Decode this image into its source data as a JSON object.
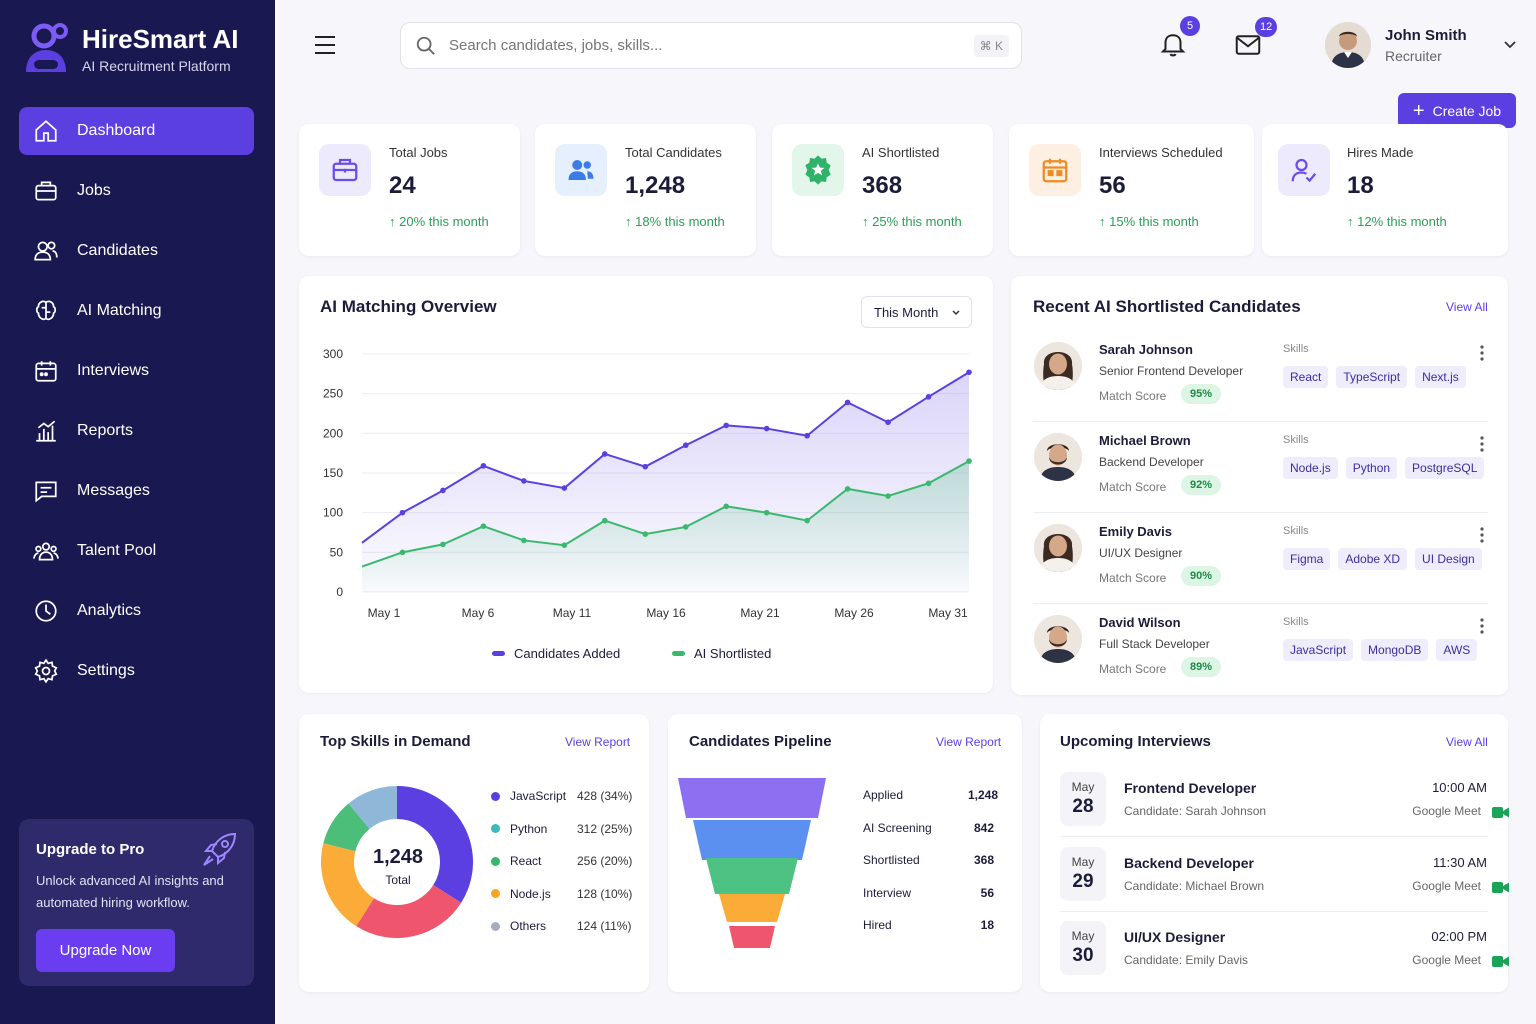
{
  "brand": {
    "name": "HireSmart AI",
    "subtitle": "AI Recruitment Platform"
  },
  "nav": [
    {
      "label": "Dashboard",
      "icon": "home-icon",
      "active": true
    },
    {
      "label": "Jobs",
      "icon": "briefcase-icon"
    },
    {
      "label": "Candidates",
      "icon": "users-icon"
    },
    {
      "label": "AI Matching",
      "icon": "brain-icon"
    },
    {
      "label": "Interviews",
      "icon": "calendar-icon"
    },
    {
      "label": "Reports",
      "icon": "bar-chart-icon"
    },
    {
      "label": "Messages",
      "icon": "message-icon"
    },
    {
      "label": "Talent Pool",
      "icon": "group-icon"
    },
    {
      "label": "Analytics",
      "icon": "clock-chart-icon"
    },
    {
      "label": "Settings",
      "icon": "gear-icon"
    }
  ],
  "upgrade": {
    "title": "Upgrade to Pro",
    "text": "Unlock advanced AI insights and automated hiring workflow.",
    "button": "Upgrade Now"
  },
  "search": {
    "placeholder": "Search candidates, jobs, skills...",
    "shortcut": "⌘ K"
  },
  "notifications": {
    "count": "5"
  },
  "messages": {
    "count": "12"
  },
  "user": {
    "name": "John Smith",
    "role": "Recruiter"
  },
  "create_job": "Create Job",
  "stats": [
    {
      "label": "Total Jobs",
      "value": "24",
      "change": "20% this month",
      "icon": "briefcase-icon",
      "color": "#6a4de8",
      "bg": "#eeeafd"
    },
    {
      "label": "Total Candidates",
      "value": "1,248",
      "change": "18% this month",
      "icon": "users-icon",
      "color": "#3d7be8",
      "bg": "#e6effd"
    },
    {
      "label": "AI Shortlisted",
      "value": "368",
      "change": "25% this month",
      "icon": "star-badge-icon",
      "color": "#2fb36a",
      "bg": "#e3f6ea"
    },
    {
      "label": "Interviews Scheduled",
      "value": "56",
      "change": "15% this month",
      "icon": "calendar-icon",
      "color": "#f08a24",
      "bg": "#fdf0e2"
    },
    {
      "label": "Hires Made",
      "value": "18",
      "change": "12% this month",
      "icon": "user-check-icon",
      "color": "#6a4de8",
      "bg": "#eeeafd"
    }
  ],
  "overview": {
    "title": "AI Matching Overview",
    "period": "This Month"
  },
  "chart_data": {
    "type": "area",
    "title": "AI Matching Overview",
    "x": [
      "May 1",
      "May 3",
      "May 5",
      "May 7",
      "May 9",
      "May 11",
      "May 13",
      "May 15",
      "May 17",
      "May 19",
      "May 21",
      "May 23",
      "May 25",
      "May 27",
      "May 29",
      "May 31"
    ],
    "x_ticks": [
      "May 1",
      "May 6",
      "May 11",
      "May 16",
      "May 21",
      "May 26",
      "May 31"
    ],
    "series": [
      {
        "name": "Candidates Added",
        "color": "#5b3fe0",
        "values": [
          62,
          100,
          128,
          159,
          140,
          131,
          174,
          158,
          185,
          210,
          206,
          197,
          239,
          214,
          246,
          277
        ]
      },
      {
        "name": "AI Shortlisted",
        "color": "#3bb86e",
        "values": [
          32,
          50,
          60,
          83,
          65,
          59,
          90,
          73,
          82,
          108,
          100,
          90,
          130,
          121,
          137,
          165
        ]
      }
    ],
    "ylim": [
      0,
      300
    ],
    "y_ticks": [
      0,
      50,
      100,
      150,
      200,
      250,
      300
    ],
    "grid": true,
    "legend": "bottom"
  },
  "recent": {
    "title": "Recent AI Shortlisted Candidates",
    "view_all": "View All",
    "skills_label": "Skills",
    "match_label": "Match Score",
    "candidates": [
      {
        "name": "Sarah Johnson",
        "role": "Senior Frontend Developer",
        "score": "95%",
        "skills": [
          "React",
          "TypeScript",
          "Next.js"
        ],
        "gender": "f"
      },
      {
        "name": "Michael Brown",
        "role": "Backend Developer",
        "score": "92%",
        "skills": [
          "Node.js",
          "Python",
          "PostgreSQL"
        ],
        "gender": "m"
      },
      {
        "name": "Emily Davis",
        "role": "UI/UX Designer",
        "score": "90%",
        "skills": [
          "Figma",
          "Adobe XD",
          "UI Design"
        ],
        "gender": "f"
      },
      {
        "name": "David Wilson",
        "role": "Full Stack Developer",
        "score": "89%",
        "skills": [
          "JavaScript",
          "MongoDB",
          "AWS"
        ],
        "gender": "m"
      }
    ]
  },
  "skills": {
    "title": "Top Skills in Demand",
    "view": "View Report",
    "total": "1,248",
    "total_label": "Total",
    "items": [
      {
        "name": "JavaScript",
        "value": "428 (34%)",
        "pct": 34,
        "color": "#5b3fe0"
      },
      {
        "name": "Python",
        "value": "312 (25%)",
        "pct": 25,
        "color": "#f0556e"
      },
      {
        "name": "React",
        "value": "256 (20%)",
        "pct": 20,
        "color": "#fbab38"
      },
      {
        "name": "Node.js",
        "value": "128 (10%)",
        "pct": 10,
        "color": "#4dbd7a"
      },
      {
        "name": "Others",
        "value": "124 (11%)",
        "pct": 11,
        "color": "#8fb8d8"
      }
    ],
    "legend_colors": [
      "#5b3fe0",
      "#3cbabc",
      "#35b86b",
      "#f6a623",
      "#a7aebf"
    ]
  },
  "pipeline": {
    "title": "Candidates Pipeline",
    "view": "View Report",
    "stages": [
      {
        "name": "Applied",
        "value": "1,248",
        "color": "#8d6ff2"
      },
      {
        "name": "AI Screening",
        "value": "842",
        "color": "#5b8ff0"
      },
      {
        "name": "Shortlisted",
        "value": "368",
        "color": "#4dc283"
      },
      {
        "name": "Interview",
        "value": "56",
        "color": "#fbab38"
      },
      {
        "name": "Hired",
        "value": "18",
        "color": "#f0556e"
      }
    ]
  },
  "interviews": {
    "title": "Upcoming Interviews",
    "view_all": "View All",
    "items": [
      {
        "month": "May",
        "day": "28",
        "title": "Frontend Developer",
        "candidate": "Candidate: Sarah Johnson",
        "time": "10:00 AM",
        "platform": "Google Meet"
      },
      {
        "month": "May",
        "day": "29",
        "title": "Backend Developer",
        "candidate": "Candidate: Michael Brown",
        "time": "11:30 AM",
        "platform": "Google Meet"
      },
      {
        "month": "May",
        "day": "30",
        "title": "UI/UX Designer",
        "candidate": "Candidate: Emily Davis",
        "time": "02:00 PM",
        "platform": "Google Meet"
      }
    ]
  }
}
